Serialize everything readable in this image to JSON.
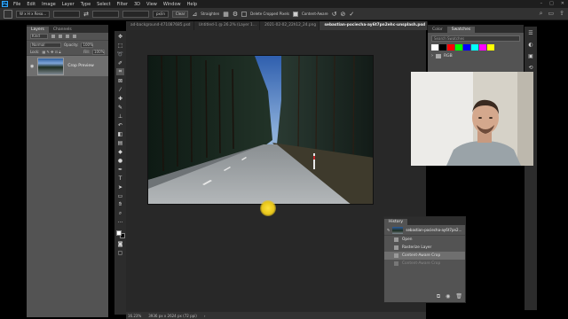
{
  "app": {
    "logo": "Ps",
    "menu": [
      "File",
      "Edit",
      "Image",
      "Layer",
      "Type",
      "Select",
      "Filter",
      "3D",
      "View",
      "Window",
      "Help"
    ],
    "window_controls": [
      "–",
      "□",
      "✕"
    ]
  },
  "options_bar": {
    "ratio": "W x H x Reso...",
    "unit": "px/in",
    "clear_label": "Clear",
    "straighten_label": "Straighten",
    "delete_cropped_label": "Delete Cropped Pixels",
    "content_aware_label": "Content-Aware"
  },
  "layers_panel": {
    "tabs": [
      "Layers",
      "Channels"
    ],
    "kind_label": "Kind",
    "blend_mode": "Normal",
    "opacity_label": "Opacity:",
    "opacity_value": "100%",
    "lock_label": "Lock:",
    "fill_label": "Fill:",
    "fill_value": "100%",
    "layer_name": "Crop Preview"
  },
  "doc_tabs": [
    "ad-background-471087685.psd",
    "Untitled-1 @ 26.2% (Layer 1...",
    "2021-02-02_22h12_24.png",
    "sebastian-pociecha-ay6t7pn2ehc-unsplash.psd"
  ],
  "status_bar": {
    "zoom": "16.23%",
    "doc_size": "3936 px x 2624 px (72 ppi)"
  },
  "swatches_panel": {
    "tabs": [
      "Color",
      "Swatches"
    ],
    "search_placeholder": "Search Swatches",
    "folder": "RGB",
    "colors": [
      "#ffffff",
      "#000000",
      "#ff0000",
      "#00ff00",
      "#0000ff",
      "#00ffff",
      "#ff00ff",
      "#ffff00"
    ]
  },
  "history_panel": {
    "tab": "History",
    "snapshot": "sebastian-pociecha-ay6t7pn2...",
    "items": [
      {
        "label": "Open",
        "state": "normal"
      },
      {
        "label": "Rasterize Layer",
        "state": "normal"
      },
      {
        "label": "Content-Aware Crop",
        "state": "selected"
      },
      {
        "label": "Content-Aware Crop",
        "state": "dim"
      }
    ]
  }
}
